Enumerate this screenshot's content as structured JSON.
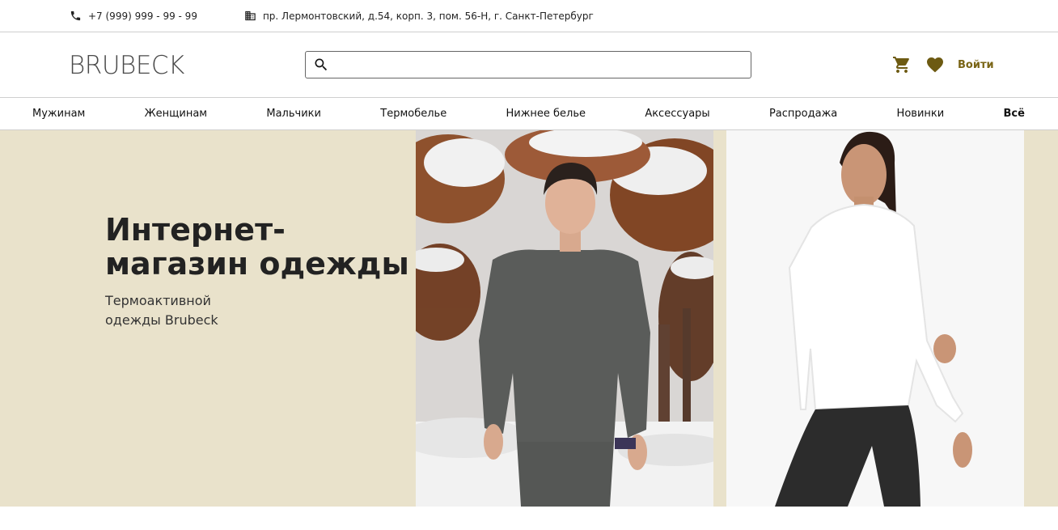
{
  "topbar": {
    "phone": "+7 (999) 999 - 99 - 99",
    "address": "пр. Лермонтовский, д.54, корп. 3, пом. 56-Н, г. Санкт-Петербург"
  },
  "header": {
    "logo": "BRUBECK",
    "search_placeholder": "",
    "login_label": "Войти"
  },
  "nav": {
    "items": [
      "Мужинам",
      "Женщинам",
      "Мальчики",
      "Термобелье",
      "Нижнее белье",
      "Аксессуары",
      "Распродажа",
      "Новинки",
      "Всё"
    ]
  },
  "hero": {
    "title": "Интернет-магазин одежды",
    "subtitle": "Термоактивной одежды Brubeck"
  },
  "colors": {
    "accent": "#6d5a12",
    "hero_bg": "#e9e2cb"
  },
  "icons": {
    "phone": "phone-icon",
    "address": "building-icon",
    "search": "search-icon",
    "cart": "cart-icon",
    "favorites": "heart-icon"
  }
}
